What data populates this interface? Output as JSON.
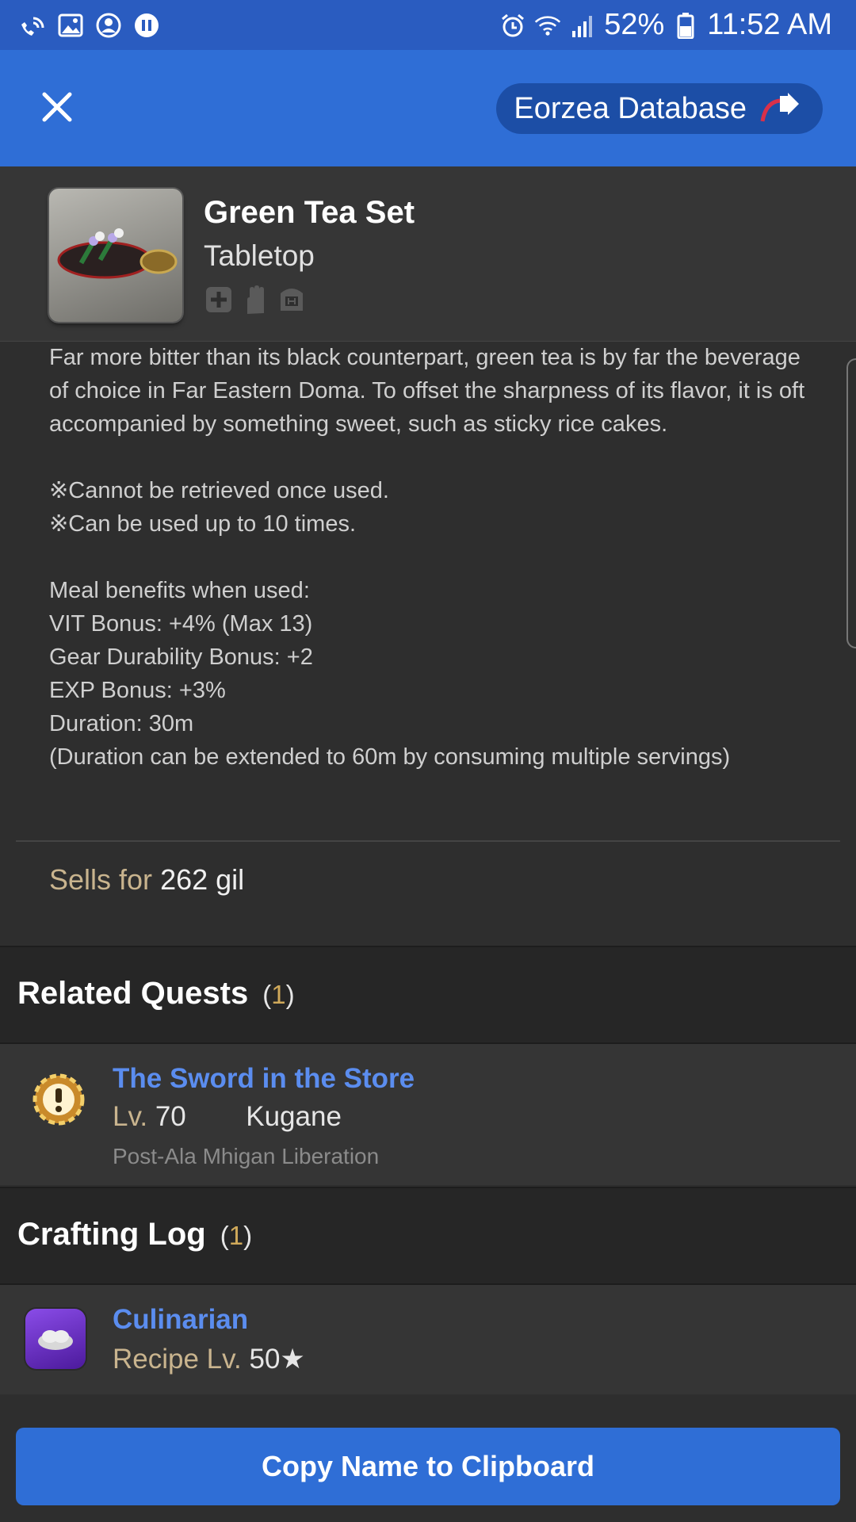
{
  "status_bar": {
    "battery": "52%",
    "time": "11:52 AM"
  },
  "app_bar": {
    "db_button_label": "Eorzea Database"
  },
  "item": {
    "name": "Green Tea Set",
    "type": "Tabletop",
    "description": [
      "Far more bitter than its black counterpart, green tea is by far the beverage of choice in Far Eastern Doma. To offset the sharpness of its flavor, it is oft accompanied by something sweet, such as sticky rice cakes.",
      "※Cannot be retrieved once used.",
      "※Can be used up to 10 times.",
      "Meal benefits when used:",
      "VIT Bonus: +4% (Max 13)",
      "Gear Durability Bonus: +2",
      "EXP Bonus: +3%",
      "Duration: 30m",
      "(Duration can be extended to 60m by consuming multiple servings)"
    ],
    "sells_label": "Sells for",
    "sells_value": "262 gil"
  },
  "related_quests": {
    "title": "Related Quests",
    "count": "1",
    "items": [
      {
        "name": "The Sword in the Store",
        "level_label": "Lv.",
        "level": "70",
        "location": "Kugane",
        "note": "Post-Ala Mhigan Liberation"
      }
    ]
  },
  "crafting_log": {
    "title": "Crafting Log",
    "count": "1",
    "items": [
      {
        "name": "Culinarian",
        "level_label": "Recipe Lv.",
        "level": "50★"
      }
    ]
  },
  "copy_button_label": "Copy Name to Clipboard",
  "colors": {
    "accent": "#2f6ed6",
    "link": "#5b8def",
    "gold_label": "#c9b48e",
    "count_number": "#d0a95a"
  }
}
